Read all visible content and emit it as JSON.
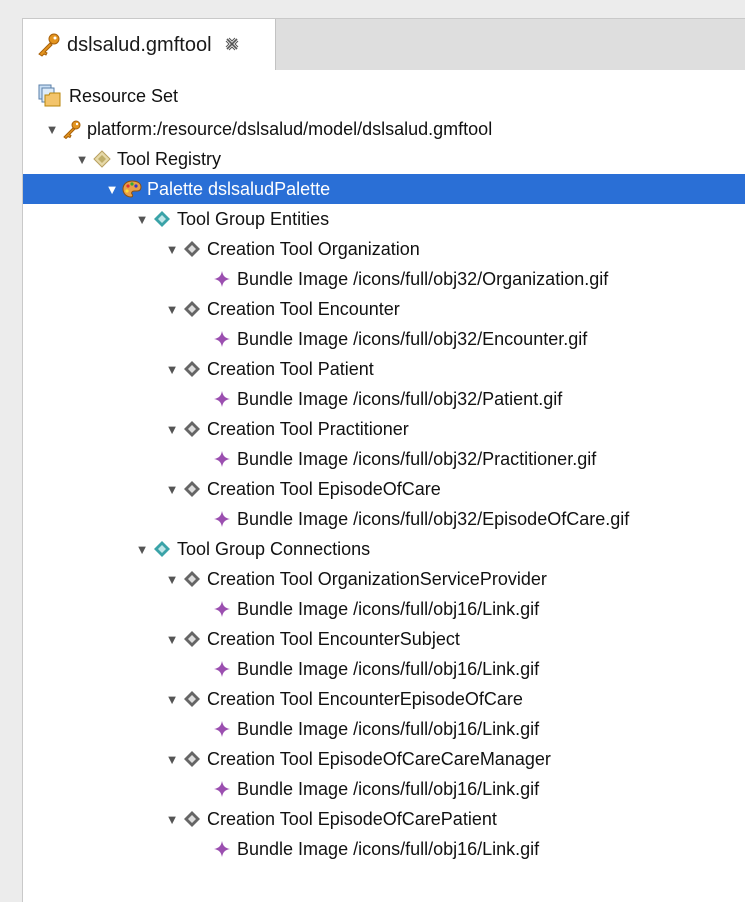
{
  "editor_tab": {
    "title": "dslsalud.gmftool",
    "close_glyph": "⎘"
  },
  "resource_set_label": "Resource Set",
  "tree": [
    {
      "level": 0,
      "expanded": true,
      "icon": "key-icon",
      "label": "platform:/resource/dslsalud/model/dslsalud.gmftool",
      "name": "tree-node-gmftool-resource"
    },
    {
      "level": 1,
      "expanded": true,
      "icon": "tool-registry-icon",
      "label": "Tool Registry",
      "name": "tree-node-tool-registry"
    },
    {
      "level": 2,
      "expanded": true,
      "icon": "palette-icon",
      "label": "Palette dslsaludPalette",
      "name": "tree-node-palette",
      "selected": true
    },
    {
      "level": 3,
      "expanded": true,
      "icon": "tool-group-icon",
      "label": "Tool Group Entities",
      "name": "tree-node-tool-group-entities"
    },
    {
      "level": 4,
      "expanded": true,
      "icon": "creation-tool-icon",
      "label": "Creation Tool Organization",
      "name": "tree-node-creation-tool"
    },
    {
      "level": 5,
      "expanded": null,
      "icon": "bundle-image-icon",
      "label": "Bundle Image /icons/full/obj32/Organization.gif",
      "name": "tree-node-bundle-image"
    },
    {
      "level": 4,
      "expanded": true,
      "icon": "creation-tool-icon",
      "label": "Creation Tool Encounter",
      "name": "tree-node-creation-tool"
    },
    {
      "level": 5,
      "expanded": null,
      "icon": "bundle-image-icon",
      "label": "Bundle Image /icons/full/obj32/Encounter.gif",
      "name": "tree-node-bundle-image"
    },
    {
      "level": 4,
      "expanded": true,
      "icon": "creation-tool-icon",
      "label": "Creation Tool Patient",
      "name": "tree-node-creation-tool"
    },
    {
      "level": 5,
      "expanded": null,
      "icon": "bundle-image-icon",
      "label": "Bundle Image /icons/full/obj32/Patient.gif",
      "name": "tree-node-bundle-image"
    },
    {
      "level": 4,
      "expanded": true,
      "icon": "creation-tool-icon",
      "label": "Creation Tool Practitioner",
      "name": "tree-node-creation-tool"
    },
    {
      "level": 5,
      "expanded": null,
      "icon": "bundle-image-icon",
      "label": "Bundle Image /icons/full/obj32/Practitioner.gif",
      "name": "tree-node-bundle-image"
    },
    {
      "level": 4,
      "expanded": true,
      "icon": "creation-tool-icon",
      "label": "Creation Tool EpisodeOfCare",
      "name": "tree-node-creation-tool"
    },
    {
      "level": 5,
      "expanded": null,
      "icon": "bundle-image-icon",
      "label": "Bundle Image /icons/full/obj32/EpisodeOfCare.gif",
      "name": "tree-node-bundle-image"
    },
    {
      "level": 3,
      "expanded": true,
      "icon": "tool-group-icon",
      "label": "Tool Group Connections",
      "name": "tree-node-tool-group-connections"
    },
    {
      "level": 4,
      "expanded": true,
      "icon": "creation-tool-icon",
      "label": "Creation Tool OrganizationServiceProvider",
      "name": "tree-node-creation-tool"
    },
    {
      "level": 5,
      "expanded": null,
      "icon": "bundle-image-icon",
      "label": "Bundle Image /icons/full/obj16/Link.gif",
      "name": "tree-node-bundle-image"
    },
    {
      "level": 4,
      "expanded": true,
      "icon": "creation-tool-icon",
      "label": "Creation Tool EncounterSubject",
      "name": "tree-node-creation-tool"
    },
    {
      "level": 5,
      "expanded": null,
      "icon": "bundle-image-icon",
      "label": "Bundle Image /icons/full/obj16/Link.gif",
      "name": "tree-node-bundle-image"
    },
    {
      "level": 4,
      "expanded": true,
      "icon": "creation-tool-icon",
      "label": "Creation Tool EncounterEpisodeOfCare",
      "name": "tree-node-creation-tool"
    },
    {
      "level": 5,
      "expanded": null,
      "icon": "bundle-image-icon",
      "label": "Bundle Image /icons/full/obj16/Link.gif",
      "name": "tree-node-bundle-image"
    },
    {
      "level": 4,
      "expanded": true,
      "icon": "creation-tool-icon",
      "label": "Creation Tool EpisodeOfCareCareManager",
      "name": "tree-node-creation-tool"
    },
    {
      "level": 5,
      "expanded": null,
      "icon": "bundle-image-icon",
      "label": "Bundle Image /icons/full/obj16/Link.gif",
      "name": "tree-node-bundle-image"
    },
    {
      "level": 4,
      "expanded": true,
      "icon": "creation-tool-icon",
      "label": "Creation Tool EpisodeOfCarePatient",
      "name": "tree-node-creation-tool"
    },
    {
      "level": 5,
      "expanded": null,
      "icon": "bundle-image-icon",
      "label": "Bundle Image /icons/full/obj16/Link.gif",
      "name": "tree-node-bundle-image"
    }
  ],
  "colors": {
    "selection": "#2a6fd6",
    "tool_group": "#3aa3a8",
    "creation_tool": "#555555",
    "bundle_image": "#9b4fb0",
    "key": "#e3941f"
  }
}
